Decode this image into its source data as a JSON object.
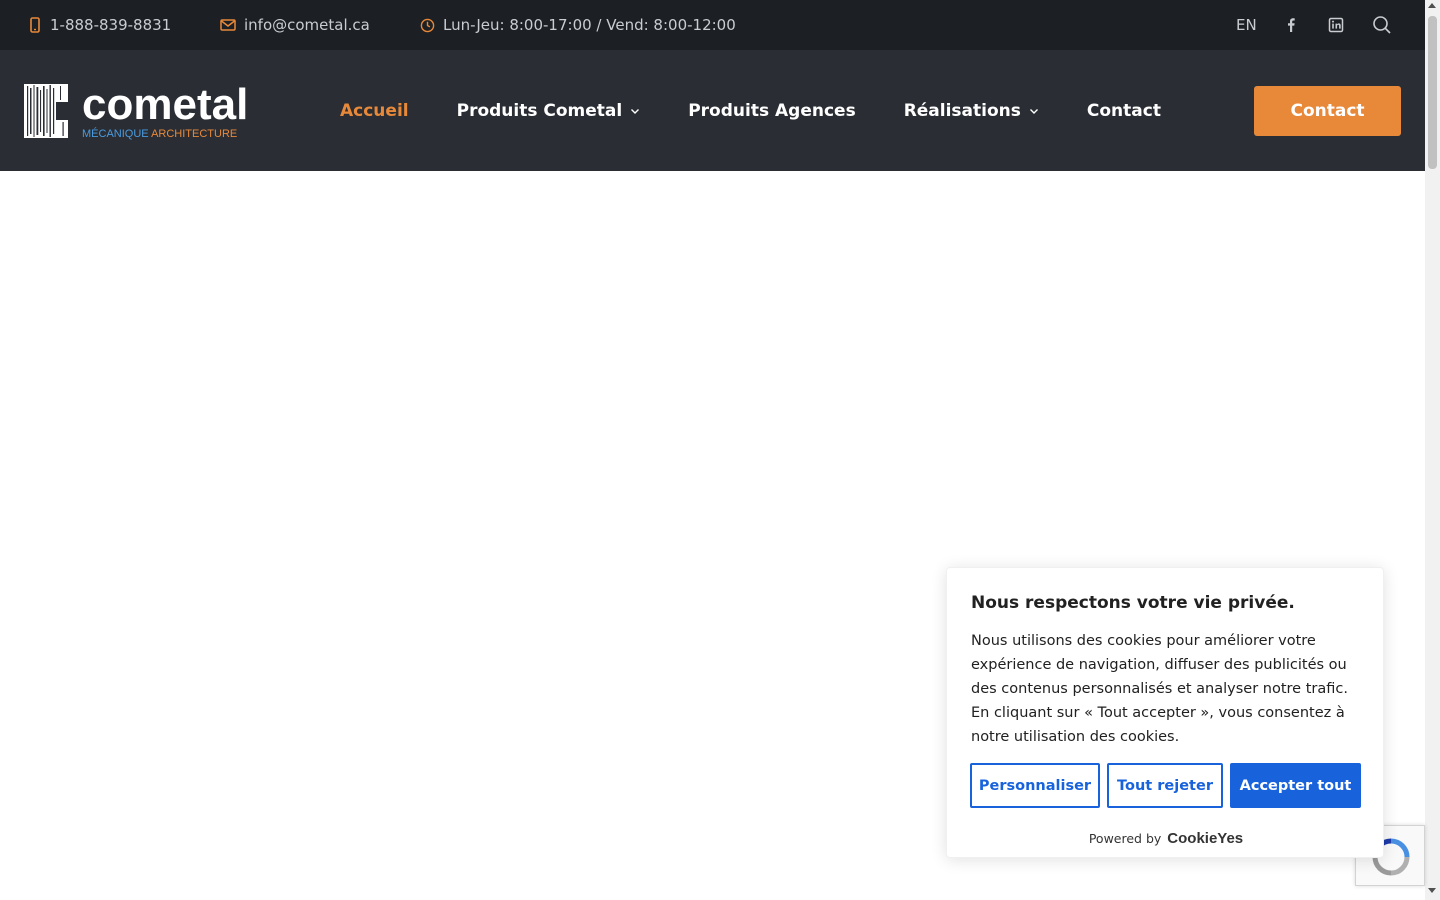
{
  "topbar": {
    "phone": "1-888-839-8831",
    "email": "info@cometal.ca",
    "hours": "Lun-Jeu: 8:00-17:00 / Vend: 8:00-12:00",
    "lang": "EN",
    "icons": [
      "phone-icon",
      "mail-icon",
      "clock-icon",
      "facebook-icon",
      "linkedin-icon",
      "search-icon"
    ],
    "icon_color": "#e8893a"
  },
  "header": {
    "logo": {
      "word": "cometal",
      "sub_a": "MÉCANIQUE",
      "sub_b": "ARCHITECTURE"
    },
    "nav": [
      {
        "label": "Accueil",
        "active": true,
        "dropdown": false
      },
      {
        "label": "Produits Cometal",
        "active": false,
        "dropdown": true
      },
      {
        "label": "Produits Agences",
        "active": false,
        "dropdown": false
      },
      {
        "label": "Réalisations",
        "active": false,
        "dropdown": true
      },
      {
        "label": "Contact",
        "active": false,
        "dropdown": false
      }
    ],
    "cta": "Contact",
    "colors": {
      "accent": "#e8893a",
      "bar": "#1c1f23",
      "header": "#2a2e34"
    }
  },
  "cookie": {
    "title": "Nous respectons votre vie privée.",
    "text": "Nous utilisons des cookies pour améliorer votre expérience de navigation, diffuser des publicités ou des contenus personnalisés et analyser notre trafic. En cliquant sur « Tout accepter », vous consentez à notre utilisation des cookies.",
    "buttons": {
      "customize": "Personnaliser",
      "reject": "Tout rejeter",
      "accept": "Accepter tout"
    },
    "powered_by": "Powered by",
    "brand": "CookieYes",
    "accent": "#1863dc"
  }
}
